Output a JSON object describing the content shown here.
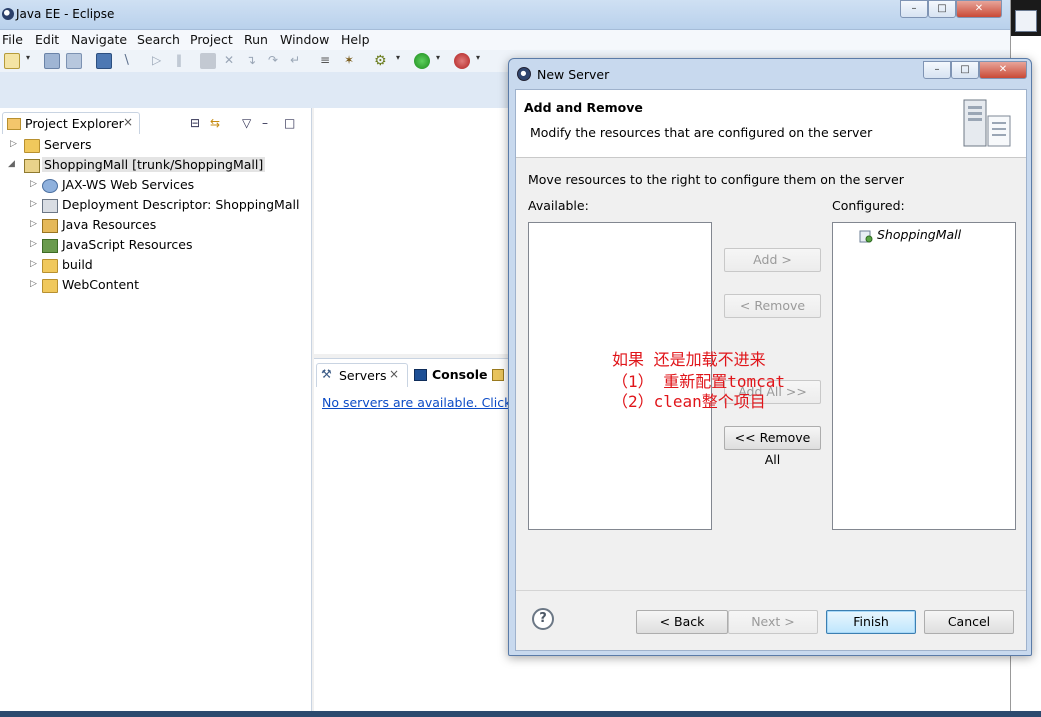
{
  "window": {
    "title": "Java EE - Eclipse"
  },
  "menu": [
    "File",
    "Edit",
    "Navigate",
    "Search",
    "Project",
    "Run",
    "Window",
    "Help"
  ],
  "project_explorer": {
    "tab_label": "Project Explorer",
    "tab_close": "×",
    "items": [
      {
        "label": "Servers",
        "arrow": "▷",
        "icon": "folder-icon",
        "level": 0
      },
      {
        "label": "ShoppingMall [trunk/ShoppingMall]",
        "arrow": "◢",
        "icon": "project-icon",
        "level": 0
      },
      {
        "label": "JAX-WS Web Services",
        "arrow": "▷",
        "icon": "webservice-icon",
        "level": 1
      },
      {
        "label": "Deployment Descriptor: ShoppingMall",
        "arrow": "▷",
        "icon": "descriptor-icon",
        "level": 1
      },
      {
        "label": "Java Resources",
        "arrow": "▷",
        "icon": "java-resources-icon",
        "level": 1
      },
      {
        "label": "JavaScript Resources",
        "arrow": "▷",
        "icon": "javascript-resources-icon",
        "level": 1
      },
      {
        "label": "build",
        "arrow": "▷",
        "icon": "folder-icon",
        "level": 1
      },
      {
        "label": "WebContent",
        "arrow": "▷",
        "icon": "folder-icon",
        "level": 1
      }
    ]
  },
  "servers_panel": {
    "servers_tab": "Servers",
    "servers_tab_close": "×",
    "console_tab": "Console",
    "empty_link": "No servers are available. Click th"
  },
  "dialog": {
    "title": "New Server",
    "heading": "Add and Remove",
    "subheading": "Modify the resources that are configured on the server",
    "instructions": "Move resources to the right to configure them on the server",
    "available_label": "Available:",
    "configured_label": "Configured:",
    "configured_items": [
      "ShoppingMall"
    ],
    "buttons": {
      "add": "Add >",
      "remove": "< Remove",
      "add_all": "Add All >>",
      "remove_all": "<< Remove All",
      "back": "< Back",
      "next": "Next >",
      "finish": "Finish",
      "cancel": "Cancel",
      "help": "?"
    }
  },
  "annotation": {
    "line1": "如果 还是加载不进来",
    "line2": "（1） 重新配置tomcat",
    "line3": "（2）clean整个项目"
  },
  "colors": {
    "annotation": "#e0151a",
    "link": "#0b4bc6",
    "dialog_frame": "#c8d9ee"
  }
}
